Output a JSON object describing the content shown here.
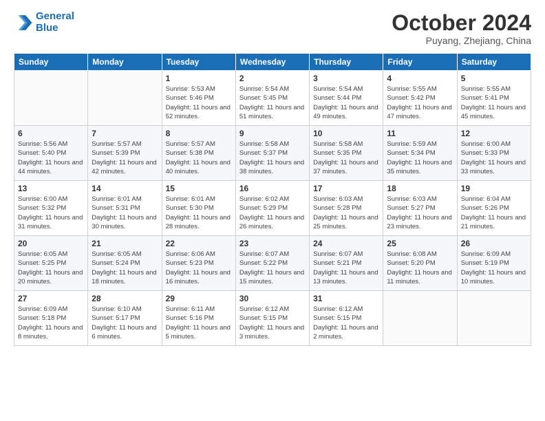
{
  "header": {
    "logo_line1": "General",
    "logo_line2": "Blue",
    "month": "October 2024",
    "location": "Puyang, Zhejiang, China"
  },
  "weekdays": [
    "Sunday",
    "Monday",
    "Tuesday",
    "Wednesday",
    "Thursday",
    "Friday",
    "Saturday"
  ],
  "weeks": [
    [
      {
        "day": "",
        "text": ""
      },
      {
        "day": "",
        "text": ""
      },
      {
        "day": "1",
        "text": "Sunrise: 5:53 AM\nSunset: 5:46 PM\nDaylight: 11 hours and 52 minutes."
      },
      {
        "day": "2",
        "text": "Sunrise: 5:54 AM\nSunset: 5:45 PM\nDaylight: 11 hours and 51 minutes."
      },
      {
        "day": "3",
        "text": "Sunrise: 5:54 AM\nSunset: 5:44 PM\nDaylight: 11 hours and 49 minutes."
      },
      {
        "day": "4",
        "text": "Sunrise: 5:55 AM\nSunset: 5:42 PM\nDaylight: 11 hours and 47 minutes."
      },
      {
        "day": "5",
        "text": "Sunrise: 5:55 AM\nSunset: 5:41 PM\nDaylight: 11 hours and 45 minutes."
      }
    ],
    [
      {
        "day": "6",
        "text": "Sunrise: 5:56 AM\nSunset: 5:40 PM\nDaylight: 11 hours and 44 minutes."
      },
      {
        "day": "7",
        "text": "Sunrise: 5:57 AM\nSunset: 5:39 PM\nDaylight: 11 hours and 42 minutes."
      },
      {
        "day": "8",
        "text": "Sunrise: 5:57 AM\nSunset: 5:38 PM\nDaylight: 11 hours and 40 minutes."
      },
      {
        "day": "9",
        "text": "Sunrise: 5:58 AM\nSunset: 5:37 PM\nDaylight: 11 hours and 38 minutes."
      },
      {
        "day": "10",
        "text": "Sunrise: 5:58 AM\nSunset: 5:35 PM\nDaylight: 11 hours and 37 minutes."
      },
      {
        "day": "11",
        "text": "Sunrise: 5:59 AM\nSunset: 5:34 PM\nDaylight: 11 hours and 35 minutes."
      },
      {
        "day": "12",
        "text": "Sunrise: 6:00 AM\nSunset: 5:33 PM\nDaylight: 11 hours and 33 minutes."
      }
    ],
    [
      {
        "day": "13",
        "text": "Sunrise: 6:00 AM\nSunset: 5:32 PM\nDaylight: 11 hours and 31 minutes."
      },
      {
        "day": "14",
        "text": "Sunrise: 6:01 AM\nSunset: 5:31 PM\nDaylight: 11 hours and 30 minutes."
      },
      {
        "day": "15",
        "text": "Sunrise: 6:01 AM\nSunset: 5:30 PM\nDaylight: 11 hours and 28 minutes."
      },
      {
        "day": "16",
        "text": "Sunrise: 6:02 AM\nSunset: 5:29 PM\nDaylight: 11 hours and 26 minutes."
      },
      {
        "day": "17",
        "text": "Sunrise: 6:03 AM\nSunset: 5:28 PM\nDaylight: 11 hours and 25 minutes."
      },
      {
        "day": "18",
        "text": "Sunrise: 6:03 AM\nSunset: 5:27 PM\nDaylight: 11 hours and 23 minutes."
      },
      {
        "day": "19",
        "text": "Sunrise: 6:04 AM\nSunset: 5:26 PM\nDaylight: 11 hours and 21 minutes."
      }
    ],
    [
      {
        "day": "20",
        "text": "Sunrise: 6:05 AM\nSunset: 5:25 PM\nDaylight: 11 hours and 20 minutes."
      },
      {
        "day": "21",
        "text": "Sunrise: 6:05 AM\nSunset: 5:24 PM\nDaylight: 11 hours and 18 minutes."
      },
      {
        "day": "22",
        "text": "Sunrise: 6:06 AM\nSunset: 5:23 PM\nDaylight: 11 hours and 16 minutes."
      },
      {
        "day": "23",
        "text": "Sunrise: 6:07 AM\nSunset: 5:22 PM\nDaylight: 11 hours and 15 minutes."
      },
      {
        "day": "24",
        "text": "Sunrise: 6:07 AM\nSunset: 5:21 PM\nDaylight: 11 hours and 13 minutes."
      },
      {
        "day": "25",
        "text": "Sunrise: 6:08 AM\nSunset: 5:20 PM\nDaylight: 11 hours and 11 minutes."
      },
      {
        "day": "26",
        "text": "Sunrise: 6:09 AM\nSunset: 5:19 PM\nDaylight: 11 hours and 10 minutes."
      }
    ],
    [
      {
        "day": "27",
        "text": "Sunrise: 6:09 AM\nSunset: 5:18 PM\nDaylight: 11 hours and 8 minutes."
      },
      {
        "day": "28",
        "text": "Sunrise: 6:10 AM\nSunset: 5:17 PM\nDaylight: 11 hours and 6 minutes."
      },
      {
        "day": "29",
        "text": "Sunrise: 6:11 AM\nSunset: 5:16 PM\nDaylight: 11 hours and 5 minutes."
      },
      {
        "day": "30",
        "text": "Sunrise: 6:12 AM\nSunset: 5:15 PM\nDaylight: 11 hours and 3 minutes."
      },
      {
        "day": "31",
        "text": "Sunrise: 6:12 AM\nSunset: 5:15 PM\nDaylight: 11 hours and 2 minutes."
      },
      {
        "day": "",
        "text": ""
      },
      {
        "day": "",
        "text": ""
      }
    ]
  ]
}
